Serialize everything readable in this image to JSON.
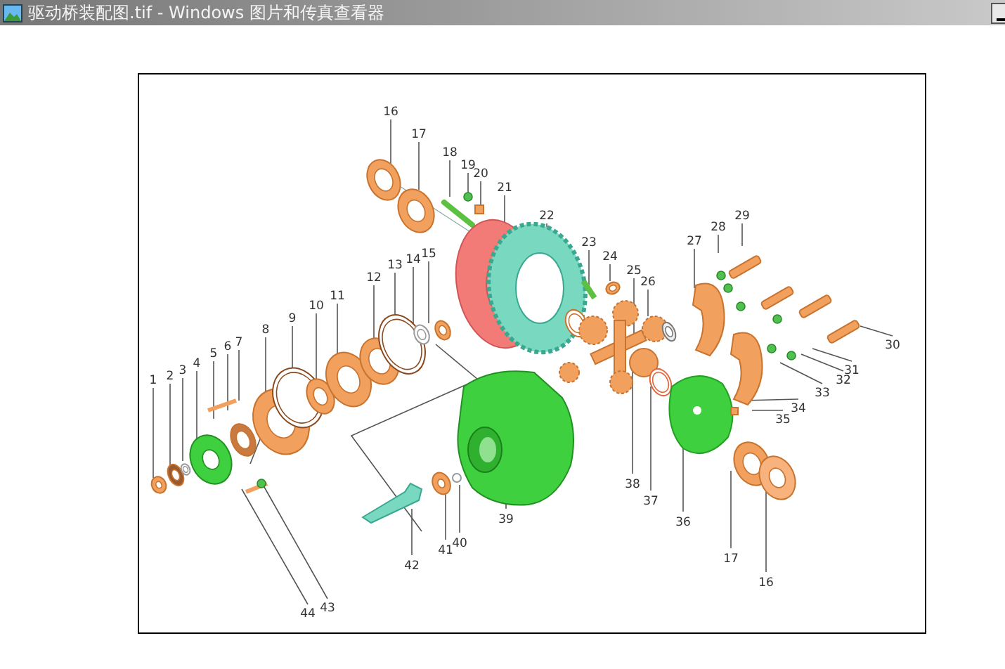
{
  "window": {
    "title": "驱动桥装配图.tif - Windows 图片和传真查看器"
  },
  "callouts": [
    {
      "label": "16"
    },
    {
      "label": "17"
    },
    {
      "label": "18"
    },
    {
      "label": "19"
    },
    {
      "label": "20"
    },
    {
      "label": "21"
    },
    {
      "label": "22"
    },
    {
      "label": "23"
    },
    {
      "label": "24"
    },
    {
      "label": "25"
    },
    {
      "label": "26"
    },
    {
      "label": "27"
    },
    {
      "label": "28"
    },
    {
      "label": "29"
    },
    {
      "label": "30"
    },
    {
      "label": "31"
    },
    {
      "label": "32"
    },
    {
      "label": "33"
    },
    {
      "label": "34"
    },
    {
      "label": "35"
    },
    {
      "label": "1"
    },
    {
      "label": "2"
    },
    {
      "label": "3"
    },
    {
      "label": "4"
    },
    {
      "label": "5"
    },
    {
      "label": "6"
    },
    {
      "label": "7"
    },
    {
      "label": "8"
    },
    {
      "label": "9"
    },
    {
      "label": "10"
    },
    {
      "label": "11"
    },
    {
      "label": "12"
    },
    {
      "label": "13"
    },
    {
      "label": "14"
    },
    {
      "label": "15"
    },
    {
      "label": "38"
    },
    {
      "label": "37"
    },
    {
      "label": "36"
    },
    {
      "label": "17"
    },
    {
      "label": "16"
    },
    {
      "label": "39"
    },
    {
      "label": "40"
    },
    {
      "label": "41"
    },
    {
      "label": "42"
    },
    {
      "label": "44"
    },
    {
      "label": "43"
    }
  ]
}
